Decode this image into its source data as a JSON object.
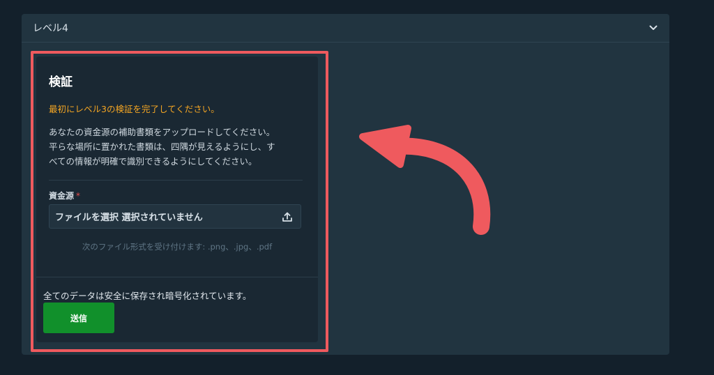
{
  "panel": {
    "title": "レベル4"
  },
  "card": {
    "title": "検証",
    "warning": "最初にレベル3の検証を完了してください。",
    "description_lines": [
      "あなたの資金源の補助書類をアップロードしてください。",
      "平らな場所に置かれた書類は、四隅が見えるようにし、す",
      "べての情報が明確で識別できるようにしてください。"
    ],
    "field_label": "資金源",
    "required_mark": "*",
    "file_input_text": "ファイルを選択 選択されていません",
    "formats_note": "次のファイル形式を受け付けます: .png、.jpg、.pdf",
    "security_note": "全てのデータは安全に保存され暗号化されています。",
    "submit_label": "送信"
  },
  "colors": {
    "background": "#13202b",
    "panel": "#213440",
    "card": "#1a2833",
    "warning": "#f5a623",
    "submit": "#11902b",
    "highlight": "#ef5a5e"
  },
  "icons": {
    "collapse": "chevron-down-icon",
    "upload": "upload-icon",
    "annotation": "curved-arrow-icon"
  }
}
